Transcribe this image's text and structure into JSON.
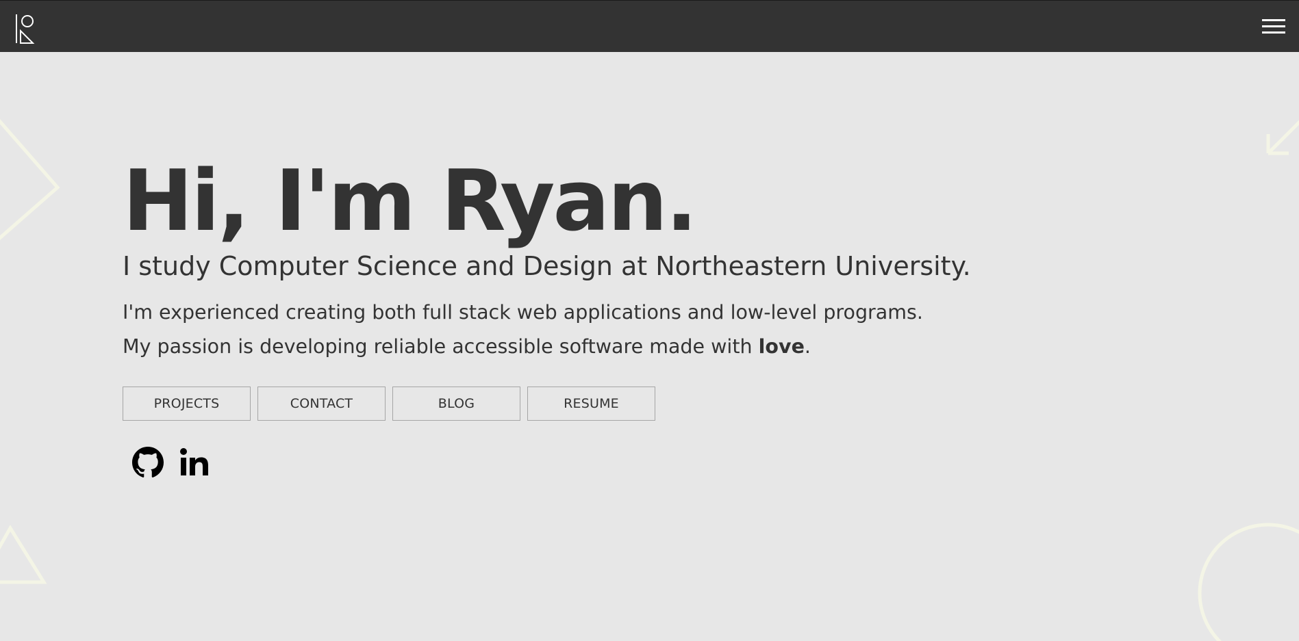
{
  "header": {
    "logo_icon": "ryan-monogram-logo",
    "menu_icon": "hamburger-menu-icon"
  },
  "hero": {
    "title": "Hi, I'm Ryan.",
    "subtitle": "I study Computer Science and Design at Northeastern University.",
    "line1": "I'm experienced creating both full stack web applications and low-level programs.",
    "line2_prefix": "My passion is developing reliable accessible software made with ",
    "line2_bold": "love",
    "line2_suffix": "."
  },
  "buttons": {
    "projects": "PROJECTS",
    "contact": "CONTACT",
    "blog": "BLOG",
    "resume": "RESUME"
  },
  "socials": {
    "github_icon": "github-icon",
    "linkedin_icon": "linkedin-icon"
  },
  "colors": {
    "background": "#e7e7e7",
    "topbar": "#333333",
    "text": "#333333",
    "decoration": "#f4f5e6",
    "button_border": "#a5a5a5"
  }
}
